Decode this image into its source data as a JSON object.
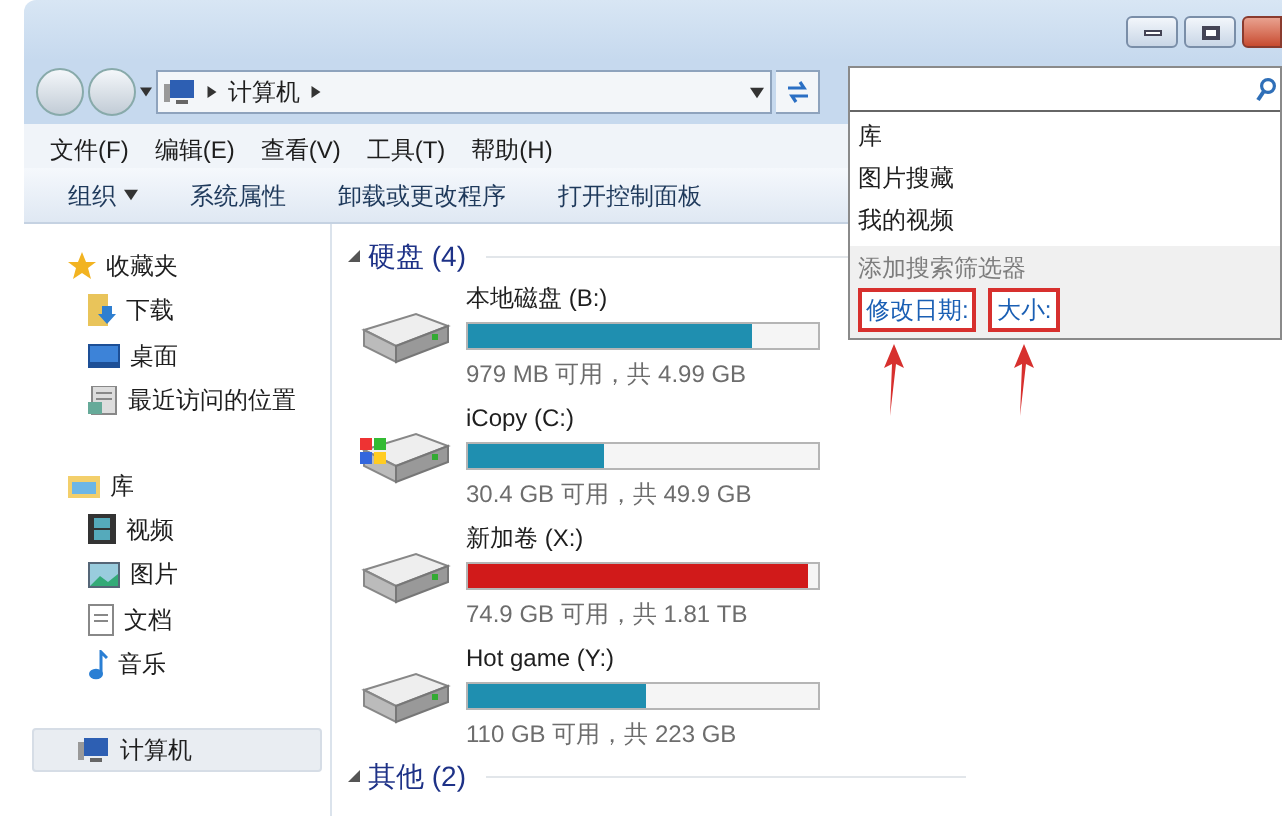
{
  "address_bar": {
    "segments": [
      "计算机"
    ]
  },
  "menu_bar": [
    "文件(F)",
    "编辑(E)",
    "查看(V)",
    "工具(T)",
    "帮助(H)"
  ],
  "toolbar": [
    {
      "label": "组织",
      "dropdown": true
    },
    {
      "label": "系统属性",
      "dropdown": false
    },
    {
      "label": "卸载或更改程序",
      "dropdown": false
    },
    {
      "label": "打开控制面板",
      "dropdown": false
    }
  ],
  "sidebar": {
    "groups": [
      {
        "label": "收藏夹",
        "kind": "favorites",
        "selected": false,
        "children": [
          {
            "label": "下载",
            "kind": "download"
          },
          {
            "label": "桌面",
            "kind": "desktop"
          },
          {
            "label": "最近访问的位置",
            "kind": "recent"
          }
        ]
      },
      {
        "label": "库",
        "kind": "library",
        "selected": false,
        "children": [
          {
            "label": "视频",
            "kind": "video"
          },
          {
            "label": "图片",
            "kind": "picture"
          },
          {
            "label": "文档",
            "kind": "document"
          },
          {
            "label": "音乐",
            "kind": "music"
          }
        ]
      },
      {
        "label": "计算机",
        "kind": "computer",
        "selected": true
      }
    ]
  },
  "content": {
    "sections": [
      {
        "title": "硬盘 (4)",
        "drives": [
          {
            "name": "本地磁盘 (B:)",
            "level": 0.81,
            "color": "#1f8fb0",
            "reading": "979 MB 可用，共 4.99 GB",
            "system": false
          },
          {
            "name": "iCopy (C:)",
            "level": 0.39,
            "color": "#1f8fb0",
            "reading": "30.4 GB 可用，共 49.9 GB",
            "system": true
          },
          {
            "name": "新加卷 (X:)",
            "level": 0.97,
            "color": "#d11a1a",
            "reading": "74.9 GB 可用，共 1.81 TB",
            "system": false
          },
          {
            "name": "Hot game (Y:)",
            "level": 0.51,
            "color": "#1f8fb0",
            "reading": "110 GB 可用，共 223 GB",
            "system": false
          }
        ]
      },
      {
        "title": "其他 (2)"
      }
    ]
  },
  "search_dropdown": {
    "suggestions": [
      "库",
      "图片搜藏",
      "我的视频"
    ],
    "filters_heading": "添加搜索筛选器",
    "filters": [
      {
        "label": "修改日期:",
        "highlighted": true
      },
      {
        "label": "大小:",
        "highlighted": true
      }
    ]
  }
}
